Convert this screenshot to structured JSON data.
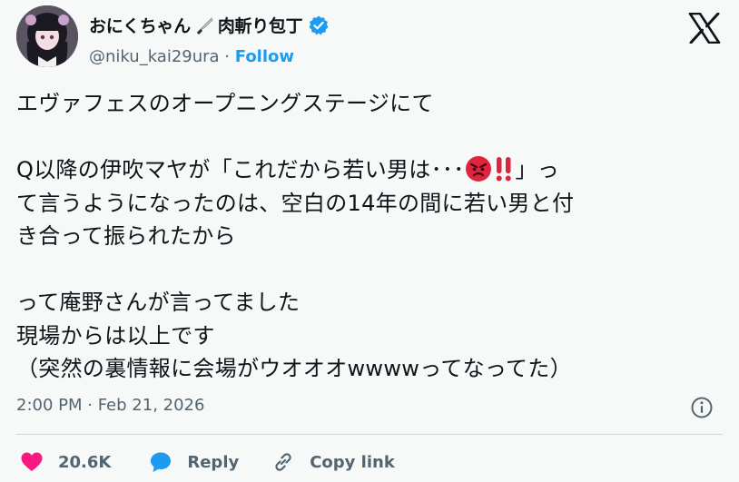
{
  "author": {
    "display_name": "おにくちゃん🔪肉斬り包丁",
    "name_text": "おにくちゃん",
    "name_suffix": "肉斬り包丁",
    "handle": "@niku_kai29ura",
    "separator": " · ",
    "follow_label": "Follow",
    "verified": true
  },
  "tweet": {
    "line1": "エヴァフェスのオープニングステージにて",
    "line2a": "Q以降の伊吹マヤが「これだから若い男は･･･",
    "line2b": "」っ",
    "line3": "て言うようになったのは、空白の14年の間に若い男と付",
    "line4": "き合って振られたから",
    "line5": "って庵野さんが言ってました",
    "line6": "現場からは以上です",
    "line7": "（突然の裏情報に会場がウオオオwwwwってなってた）"
  },
  "meta": {
    "timestamp": "2:00 PM · Feb 21, 2026"
  },
  "actions": {
    "likes_count": "20.6K",
    "reply_label": "Reply",
    "copy_label": "Copy link"
  },
  "colors": {
    "accent": "#1d9bf0",
    "like": "#f91880",
    "muted": "#536471",
    "background": "#f7f9f9"
  },
  "icons": [
    "knife-icon",
    "verified-badge-icon",
    "x-logo-icon",
    "angry-face-emoji",
    "double-exclamation-emoji",
    "info-icon",
    "heart-icon",
    "reply-bubble-icon",
    "link-icon"
  ]
}
